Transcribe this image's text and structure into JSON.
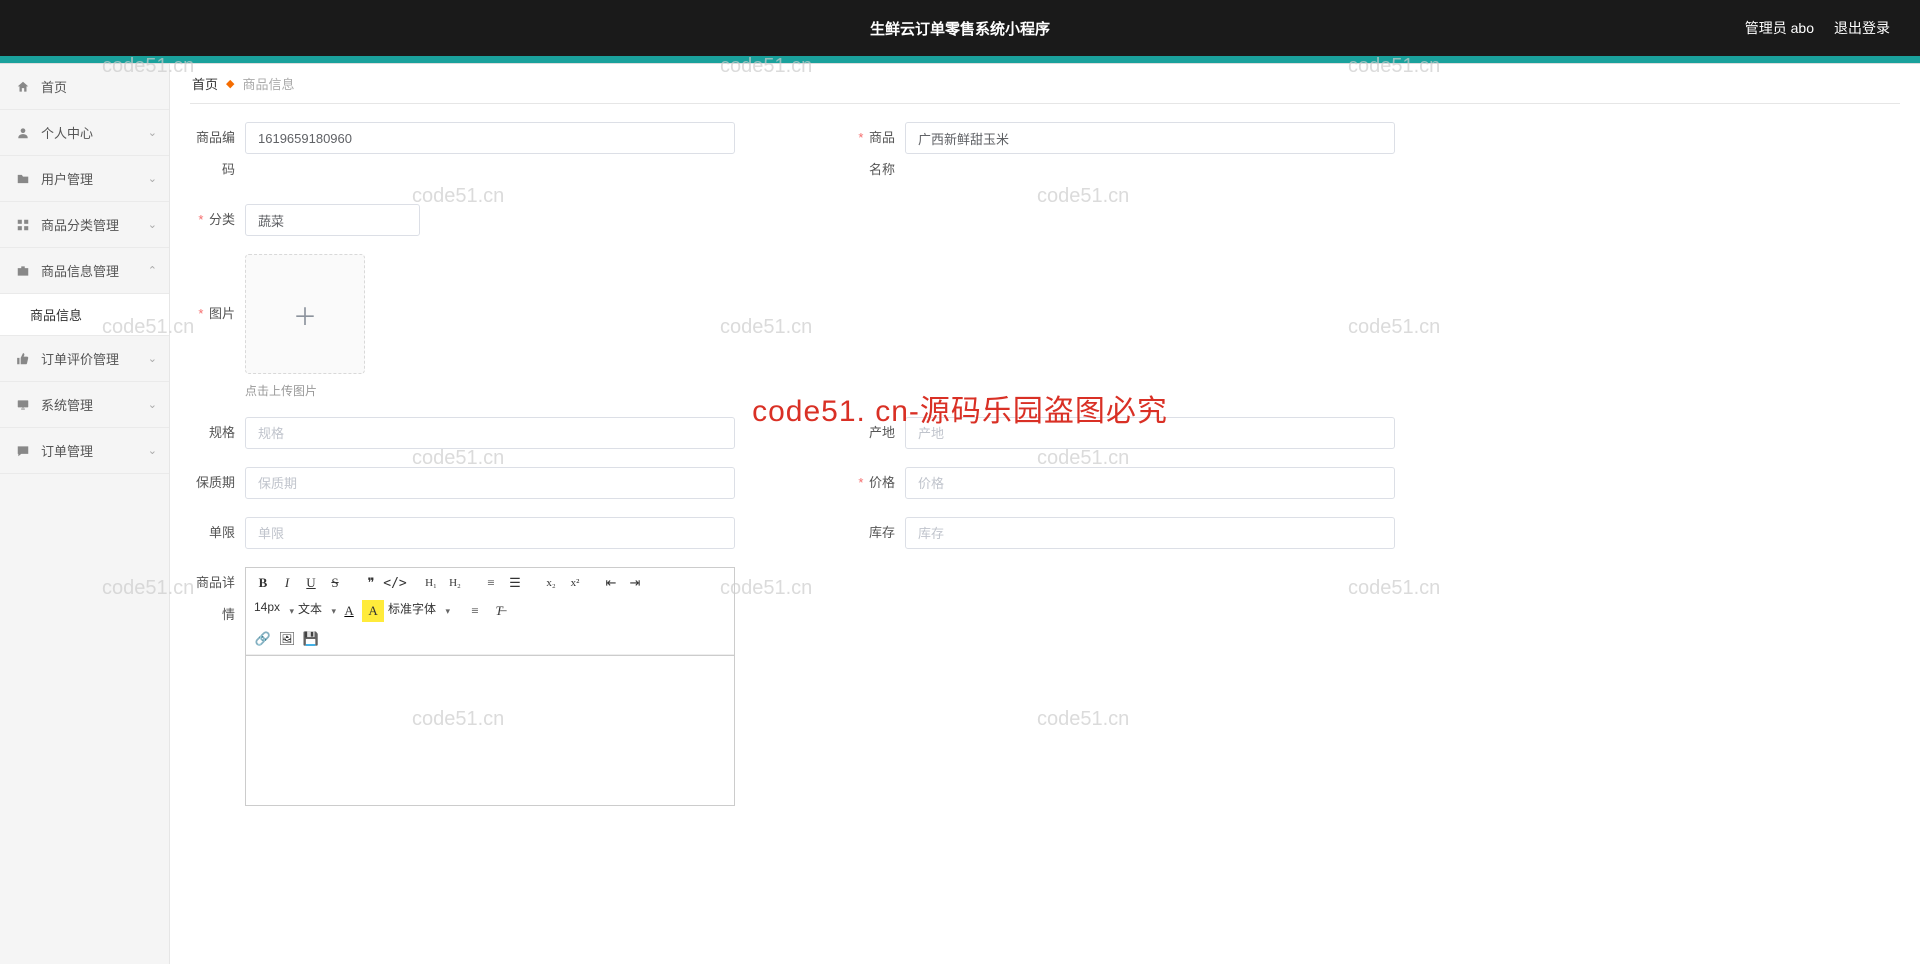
{
  "header": {
    "title": "生鲜云订单零售系统小程序",
    "admin_label": "管理员 abo",
    "logout_label": "退出登录"
  },
  "sidebar": {
    "items": [
      {
        "label": "首页",
        "icon": "home",
        "expandable": false
      },
      {
        "label": "个人中心",
        "icon": "user",
        "expandable": true
      },
      {
        "label": "用户管理",
        "icon": "folder",
        "expandable": true
      },
      {
        "label": "商品分类管理",
        "icon": "grid",
        "expandable": true
      },
      {
        "label": "商品信息管理",
        "icon": "briefcase",
        "expandable": true,
        "expanded": true,
        "children": [
          {
            "label": "商品信息"
          }
        ]
      },
      {
        "label": "订单评价管理",
        "icon": "thumb",
        "expandable": true
      },
      {
        "label": "系统管理",
        "icon": "desktop",
        "expandable": true
      },
      {
        "label": "订单管理",
        "icon": "chat",
        "expandable": true
      }
    ]
  },
  "breadcrumb": {
    "home": "首页",
    "current": "商品信息"
  },
  "form": {
    "product_code": {
      "label": "商品编码",
      "value": "1619659180960"
    },
    "product_name": {
      "label": "商品名称",
      "value": "广西新鲜甜玉米",
      "required": true
    },
    "category": {
      "label": "分类",
      "value": "蔬菜",
      "required": true
    },
    "image": {
      "label": "图片",
      "hint": "点击上传图片",
      "required": true
    },
    "spec": {
      "label": "规格",
      "placeholder": "规格"
    },
    "origin": {
      "label": "产地",
      "placeholder": "产地"
    },
    "shelf_life": {
      "label": "保质期",
      "placeholder": "保质期"
    },
    "price": {
      "label": "价格",
      "placeholder": "价格",
      "required": true
    },
    "limit": {
      "label": "单限",
      "placeholder": "单限"
    },
    "stock": {
      "label": "库存",
      "placeholder": "库存"
    },
    "detail": {
      "label": "商品详情"
    }
  },
  "editor": {
    "font_size": "14px",
    "text_style": "文本",
    "font_family": "标准字体"
  },
  "watermarks": {
    "small": "code51.cn",
    "big": "code51. cn-源码乐园盗图必究"
  }
}
